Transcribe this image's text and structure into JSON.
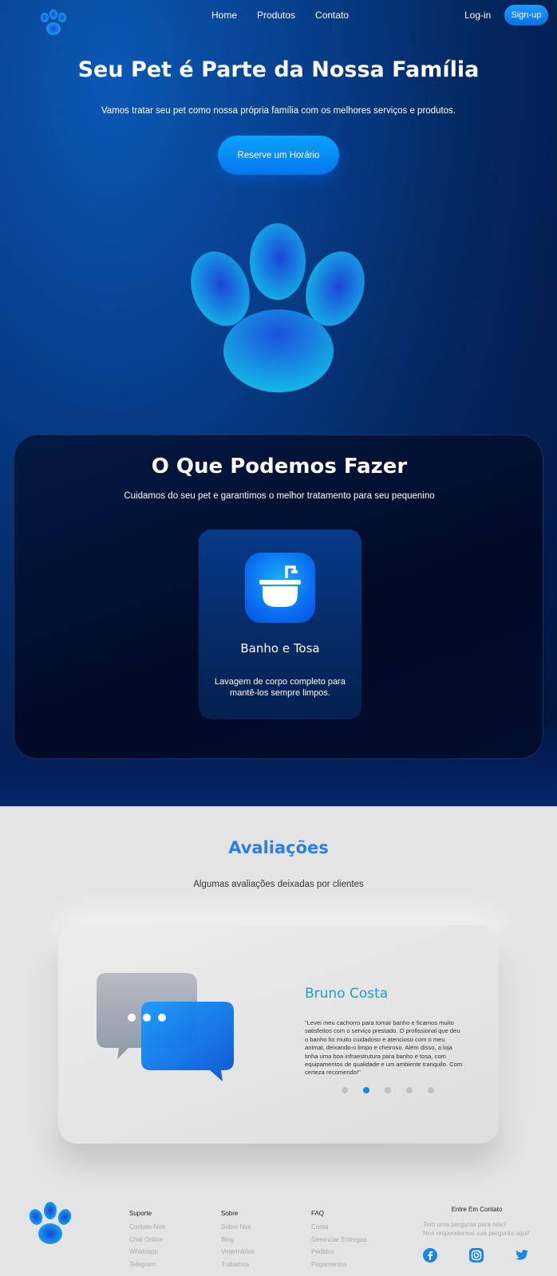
{
  "nav": {
    "links": [
      "Home",
      "Produtos",
      "Contato"
    ],
    "login": "Log-in",
    "signup": "Sign-up",
    "logo_icon": "paw-icon"
  },
  "hero": {
    "title": "Seu Pet é Parte da Nossa Família",
    "subtitle": "Vamos tratar seu pet como nossa própria família com os melhores serviços e produtos.",
    "cta": "Reserve um Horário",
    "illustration": "paw-icon"
  },
  "services": {
    "title": "O Que Podemos Fazer",
    "subtitle": "Cuidamos do seu pet e garantimos o melhor tratamento para seu pequenino",
    "card": {
      "icon": "bathtub-icon",
      "name": "Banho e Tosa",
      "description": "Lavagem de corpo completo para mantê-los sempre limpos."
    }
  },
  "reviews": {
    "title": "Avaliações",
    "subtitle": "Algumas avaliações deixadas por clientes",
    "illustration": "chat-bubbles-icon",
    "reviewer": "Bruno Costa",
    "text": "\"Levei meu cachorro para tomar banho e ficamos muito satisfeitos com o serviço prestado. O profissional que deu o banho foi muito cuidadoso e atencioso com o meu animal, deixando-o limpo e cheiroso. Além disso, a loja tinha uma boa infraestrutura para banho e tosa, com equipamentos de qualidade e um ambiente tranquilo. Com certeza recomendo!\"",
    "dots_total": 5,
    "active_dot": 2
  },
  "footer": {
    "columns": [
      {
        "title": "Suporte",
        "items": [
          "Contate-Nos",
          "Chat Online",
          "Whatsapp",
          "Telegram"
        ]
      },
      {
        "title": "Sobre",
        "items": [
          "Sobre Nos",
          "Blog",
          "Veterinários",
          "Trabalhos"
        ]
      },
      {
        "title": "FAQ",
        "items": [
          "Conta",
          "Gerenciar Entregas",
          "Pedidos",
          "Pagamentos"
        ]
      }
    ],
    "contact_title": "Entre Em Contato",
    "contact_line1": "Tem uma pergunta para nós?",
    "contact_line2": "Nos respondemos sua pergunta aqui!",
    "social_icons": [
      "facebook-icon",
      "instagram-icon",
      "twitter-icon"
    ],
    "social_color": "#1a86e8"
  }
}
